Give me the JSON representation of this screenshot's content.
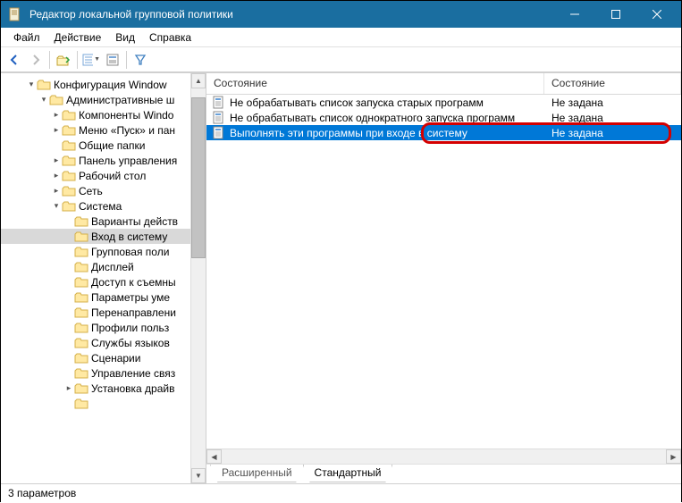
{
  "window": {
    "title": "Редактор локальной групповой политики"
  },
  "menu": {
    "file": "Файл",
    "action": "Действие",
    "view": "Вид",
    "help": "Справка"
  },
  "tree": [
    {
      "indent": 2,
      "twisty": "▾",
      "label": "Конфигурация Window"
    },
    {
      "indent": 3,
      "twisty": "▾",
      "label": "Административные ш"
    },
    {
      "indent": 4,
      "twisty": "▸",
      "label": "Компоненты Windo"
    },
    {
      "indent": 4,
      "twisty": "▸",
      "label": "Меню «Пуск» и пан"
    },
    {
      "indent": 4,
      "twisty": "",
      "label": "Общие папки"
    },
    {
      "indent": 4,
      "twisty": "▸",
      "label": "Панель управления"
    },
    {
      "indent": 4,
      "twisty": "▸",
      "label": "Рабочий стол"
    },
    {
      "indent": 4,
      "twisty": "▸",
      "label": "Сеть"
    },
    {
      "indent": 4,
      "twisty": "▾",
      "label": "Система"
    },
    {
      "indent": 5,
      "twisty": "",
      "label": "Варианты действ"
    },
    {
      "indent": 5,
      "twisty": "",
      "label": "Вход в систему",
      "selected": true
    },
    {
      "indent": 5,
      "twisty": "",
      "label": "Групповая поли"
    },
    {
      "indent": 5,
      "twisty": "",
      "label": "Дисплей"
    },
    {
      "indent": 5,
      "twisty": "",
      "label": "Доступ к съемны"
    },
    {
      "indent": 5,
      "twisty": "",
      "label": "Параметры уме"
    },
    {
      "indent": 5,
      "twisty": "",
      "label": "Перенаправлени"
    },
    {
      "indent": 5,
      "twisty": "",
      "label": "Профили польз"
    },
    {
      "indent": 5,
      "twisty": "",
      "label": "Службы языков"
    },
    {
      "indent": 5,
      "twisty": "",
      "label": "Сценарии"
    },
    {
      "indent": 5,
      "twisty": "",
      "label": "Управление связ"
    },
    {
      "indent": 5,
      "twisty": "▸",
      "label": "Установка драйв"
    },
    {
      "indent": 5,
      "twisty": "",
      "label": ""
    }
  ],
  "list": {
    "headers": {
      "state": "Состояние",
      "status": "Состояние"
    },
    "rows": [
      {
        "name": "Не обрабатывать список запуска старых программ",
        "status": "Не задана"
      },
      {
        "name": "Не обрабатывать список однократного запуска программ",
        "status": "Не задана"
      },
      {
        "name": "Выполнять эти программы при входе в систему",
        "status": "Не задана",
        "selected": true
      }
    ]
  },
  "tabs": {
    "extended": "Расширенный",
    "standard": "Стандартный"
  },
  "status": "3 параметров"
}
